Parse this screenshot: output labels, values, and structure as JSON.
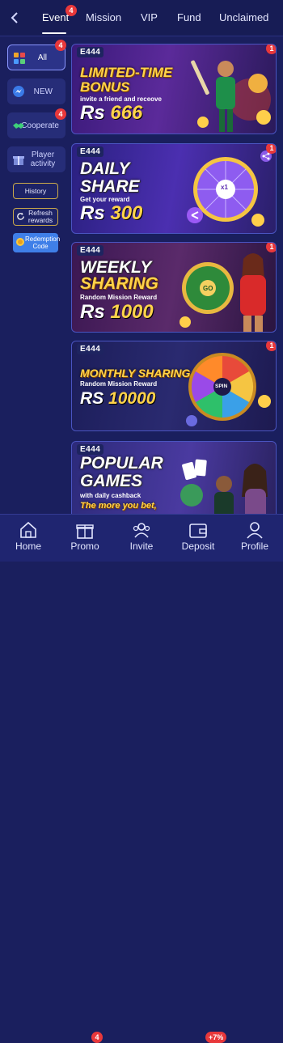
{
  "tabs": [
    {
      "label": "Event",
      "badge": "4"
    },
    {
      "label": "Mission"
    },
    {
      "label": "VIP"
    },
    {
      "label": "Fund"
    },
    {
      "label": "Unclaimed"
    }
  ],
  "sidebar": {
    "items": [
      {
        "label": "All",
        "badge": "4"
      },
      {
        "label": "NEW"
      },
      {
        "label": "Cooperate",
        "badge": "4"
      },
      {
        "label": "Player activity"
      }
    ],
    "buttons": [
      {
        "label": "History"
      },
      {
        "label": "Refresh rewards"
      },
      {
        "label": "Redemption Code"
      }
    ]
  },
  "banners": [
    {
      "brand": "E444",
      "line1": "LIMITED-TIME",
      "line2": "BONUS",
      "sub": "invite a friend and receove",
      "currency": "Rs",
      "amount": "666",
      "badge": "1"
    },
    {
      "brand": "E444",
      "line1": "DAILY",
      "line2": "SHARE",
      "sub": "Get your reward",
      "currency": "Rs",
      "amount": "300",
      "badge": "1",
      "wheel_text": "x1"
    },
    {
      "brand": "E444",
      "line1": "WEEKLY",
      "line2": "SHARING",
      "sub": "Random Mission Reward",
      "currency": "Rs",
      "amount": "1000",
      "badge": "1",
      "wheel_text": "GO"
    },
    {
      "brand": "E444",
      "line1": "MONTHLY SHARING",
      "sub": "Random Mission Reward",
      "currency": "RS",
      "amount": "10000",
      "badge": "1",
      "wheel_text": "SPIN"
    },
    {
      "brand": "E444",
      "line1": "POPULAR",
      "line2": "GAMES",
      "sub": "with daily cashback",
      "sub2": "The more you bet,"
    }
  ],
  "bottom_nav": [
    {
      "label": "Home"
    },
    {
      "label": "Promo",
      "badge": "4"
    },
    {
      "label": "Invite"
    },
    {
      "label": "Deposit",
      "badge": "+7%"
    },
    {
      "label": "Profile"
    }
  ],
  "colors": {
    "background": "#1a1f5e",
    "badge": "#e8383b",
    "gold": "#ffd34a",
    "accent_blue": "#3f7fe8"
  }
}
